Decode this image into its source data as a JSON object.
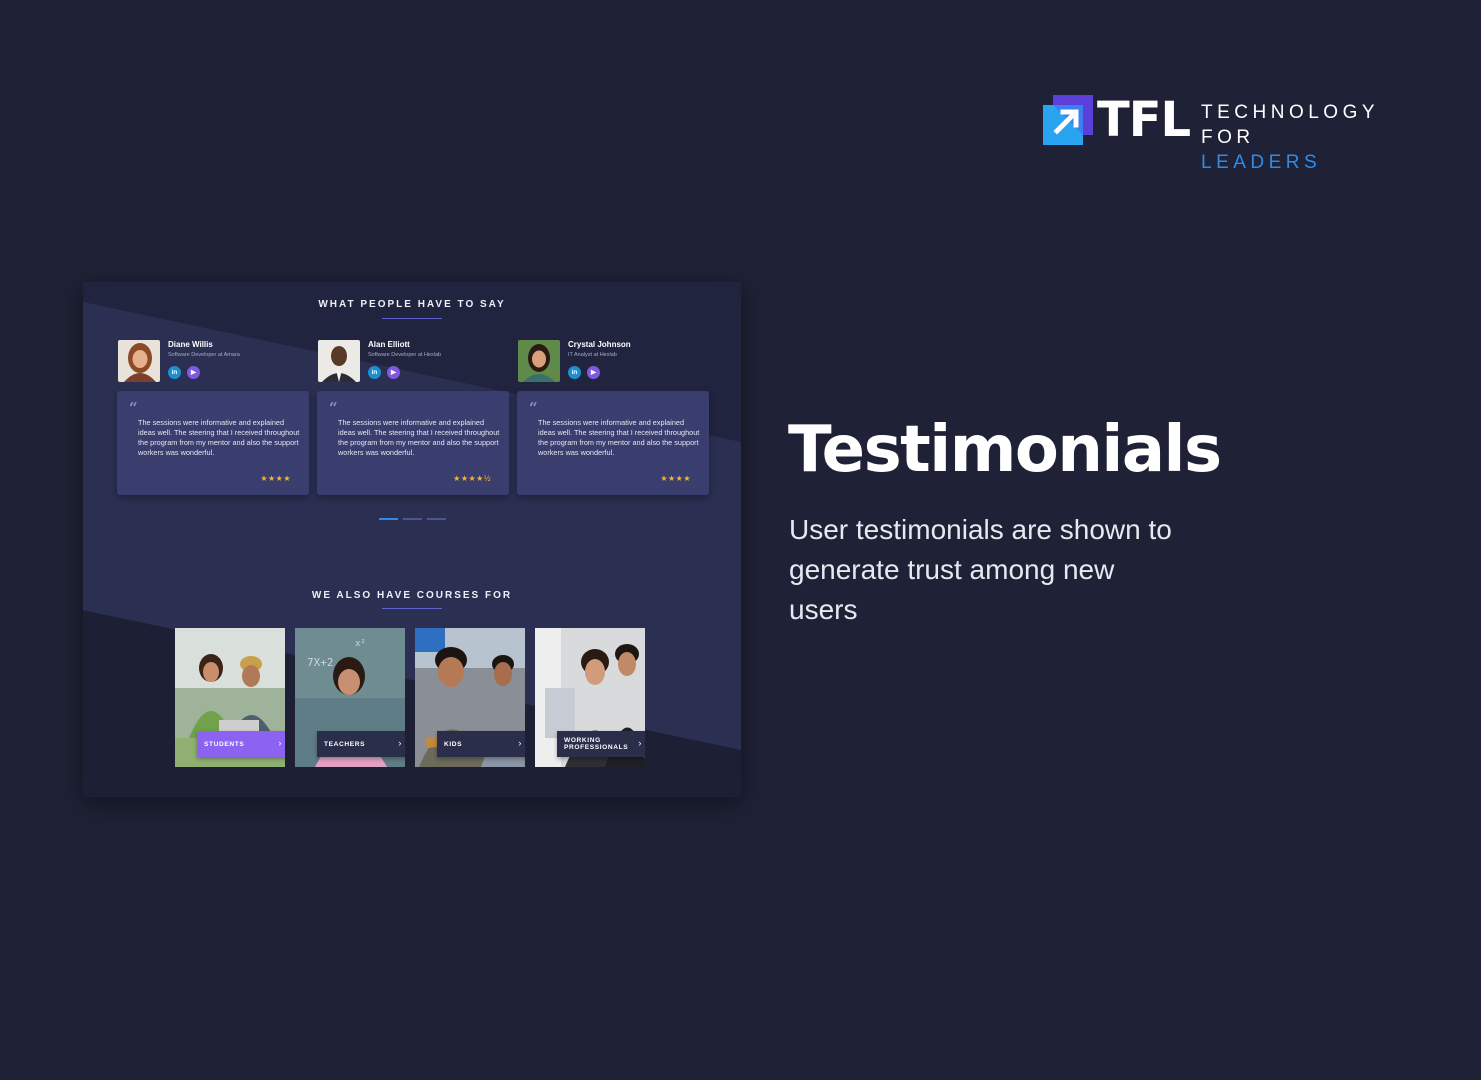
{
  "brand": {
    "logo_text": "TFL",
    "line1": "TECHNOLOGY",
    "line2_prefix": "FOR",
    "line2_highlight": "LEADERS"
  },
  "headline": "Testimonials",
  "subtext": "User testimonials are shown to generate trust among new users",
  "mockup": {
    "testimonials_title": "WHAT PEOPLE HAVE TO SAY",
    "testimonials": [
      {
        "name": "Diane Willis",
        "role": "Software Developer at  Amara",
        "text": "The sessions were informative and explained ideas well. The steering that I received throughout the program from my mentor and also the support workers was wonderful.",
        "stars": "★★★★",
        "rating": 4
      },
      {
        "name": "Alan Elliott",
        "role": "Software Developer at  Hexlab",
        "text": "The sessions were informative and explained ideas well. The steering that I received throughout the program from my mentor and also the support workers was wonderful.",
        "stars": "★★★★½",
        "rating": 4.5
      },
      {
        "name": "Crystal Johnson",
        "role": "IT Analyst at  Hexlab",
        "text": "The sessions were informative and explained ideas well. The steering that I received throughout the program from my mentor and also the support workers was wonderful.",
        "stars": "★★★★",
        "rating": 4
      }
    ],
    "social": {
      "linkedin": "in",
      "play": "▶"
    },
    "quote_mark": "“",
    "carousel": {
      "pages": 3,
      "active_index": 0
    },
    "courses_title": "WE ALSO HAVE COURSES FOR",
    "courses": [
      {
        "label": "STUDENTS",
        "active": true
      },
      {
        "label": "TEACHERS",
        "active": false
      },
      {
        "label": "KIDS",
        "active": false
      },
      {
        "label": "WORKING PROFESSIONALS",
        "active": false
      }
    ],
    "chevron": "›"
  },
  "colors": {
    "page_background": "#1f2236",
    "mockup_background": "#272a47",
    "card_background": "#3a3e6e",
    "accent_blue": "#2f8be6",
    "accent_purple": "#8b63f0",
    "star": "#f5b82a"
  }
}
